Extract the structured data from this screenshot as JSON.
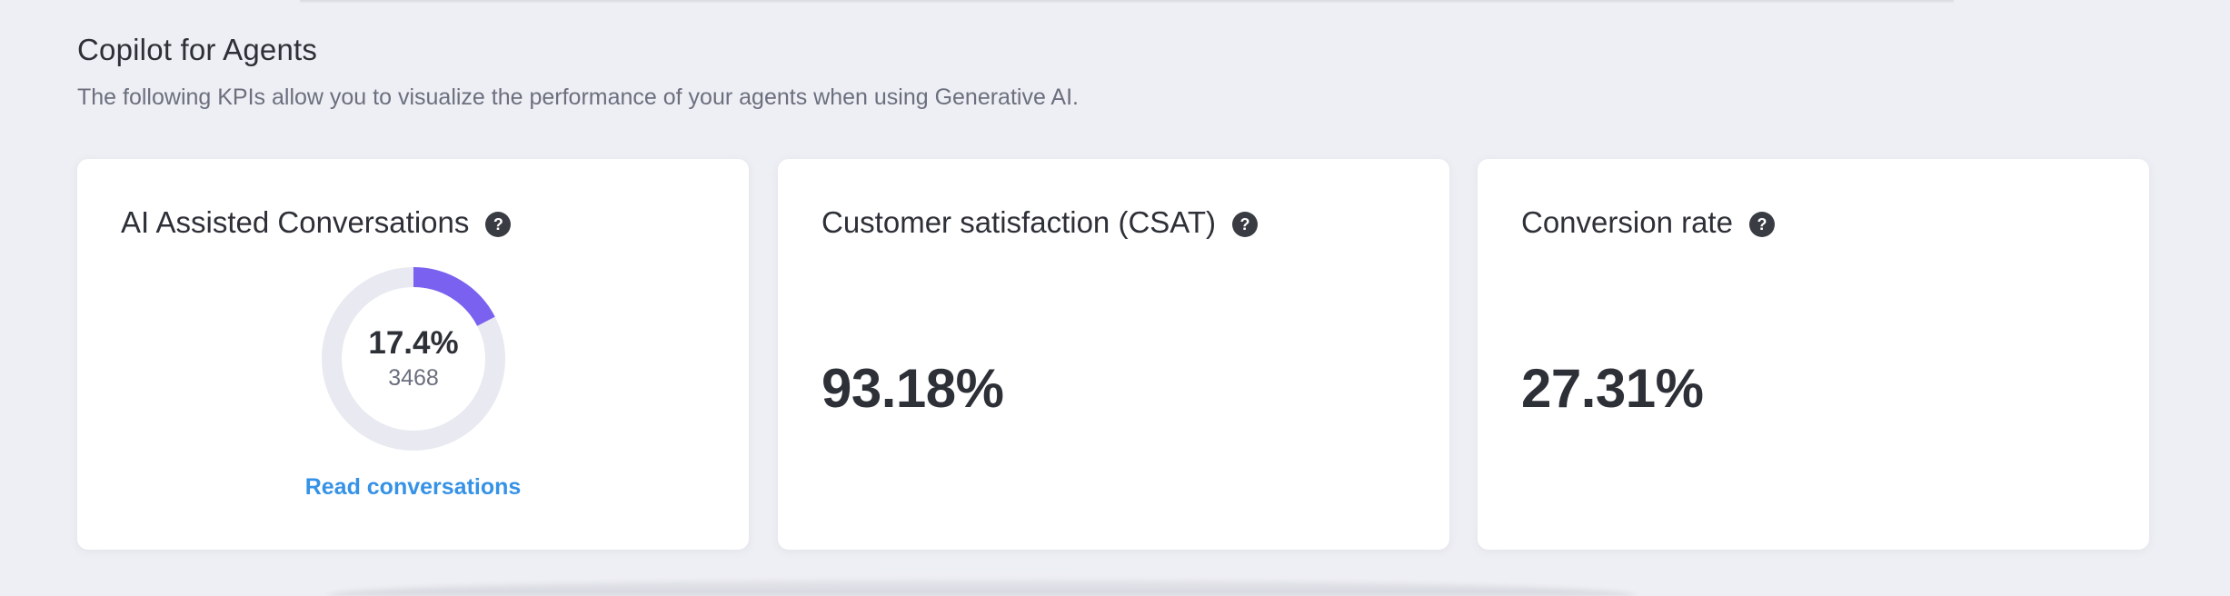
{
  "section": {
    "title": "Copilot for Agents",
    "subtitle": "The following KPIs allow you to visualize the performance of your agents when using Generative AI."
  },
  "cards": [
    {
      "title": "AI Assisted Conversations",
      "help_icon": "question-mark-icon",
      "percentage_label": "17.4%",
      "percentage_value": 17.4,
      "count": "3468",
      "link_label": "Read conversations"
    },
    {
      "title": "Customer satisfaction (CSAT)",
      "help_icon": "question-mark-icon",
      "value": "93.18%"
    },
    {
      "title": "Conversion rate",
      "help_icon": "question-mark-icon",
      "value": "27.31%"
    }
  ],
  "colors": {
    "background": "#eeeff4",
    "card": "#ffffff",
    "text_primary": "#2e3038",
    "text_secondary": "#6b6f7e",
    "donut_fill": "#7b61f0",
    "donut_track": "#e8e9f1",
    "link": "#3592e6",
    "help_icon_bg": "#3a3c44"
  }
}
